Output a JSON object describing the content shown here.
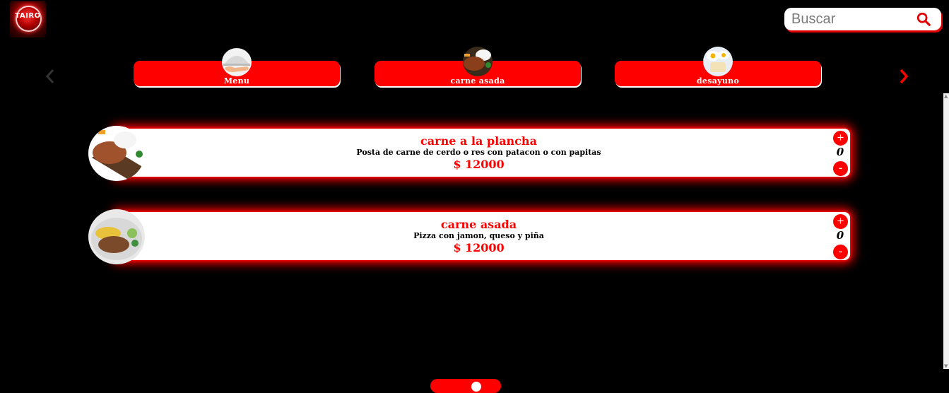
{
  "logo": {
    "text": "TAIRO"
  },
  "search": {
    "placeholder": "Buscar",
    "icon": "search-icon"
  },
  "colors": {
    "accent": "#ff0000",
    "background": "#000000",
    "card": "#ffffff"
  },
  "categories": [
    {
      "label": "Menu",
      "icon": "cloche-icon"
    },
    {
      "label": "carne asada",
      "icon": "grilled-meat-icon"
    },
    {
      "label": "desayuno",
      "icon": "breakfast-eggs-icon"
    }
  ],
  "products": [
    {
      "name": "carne a la plancha",
      "description": "Posta de carne de cerdo o res con patacon o con papitas",
      "price": "$ 12000",
      "quantity": "0",
      "plus": "+",
      "minus": "-"
    },
    {
      "name": "carne asada",
      "description": "Pizza con jamon, queso y piña",
      "price": "$ 12000",
      "quantity": "0",
      "plus": "+",
      "minus": "-"
    }
  ]
}
